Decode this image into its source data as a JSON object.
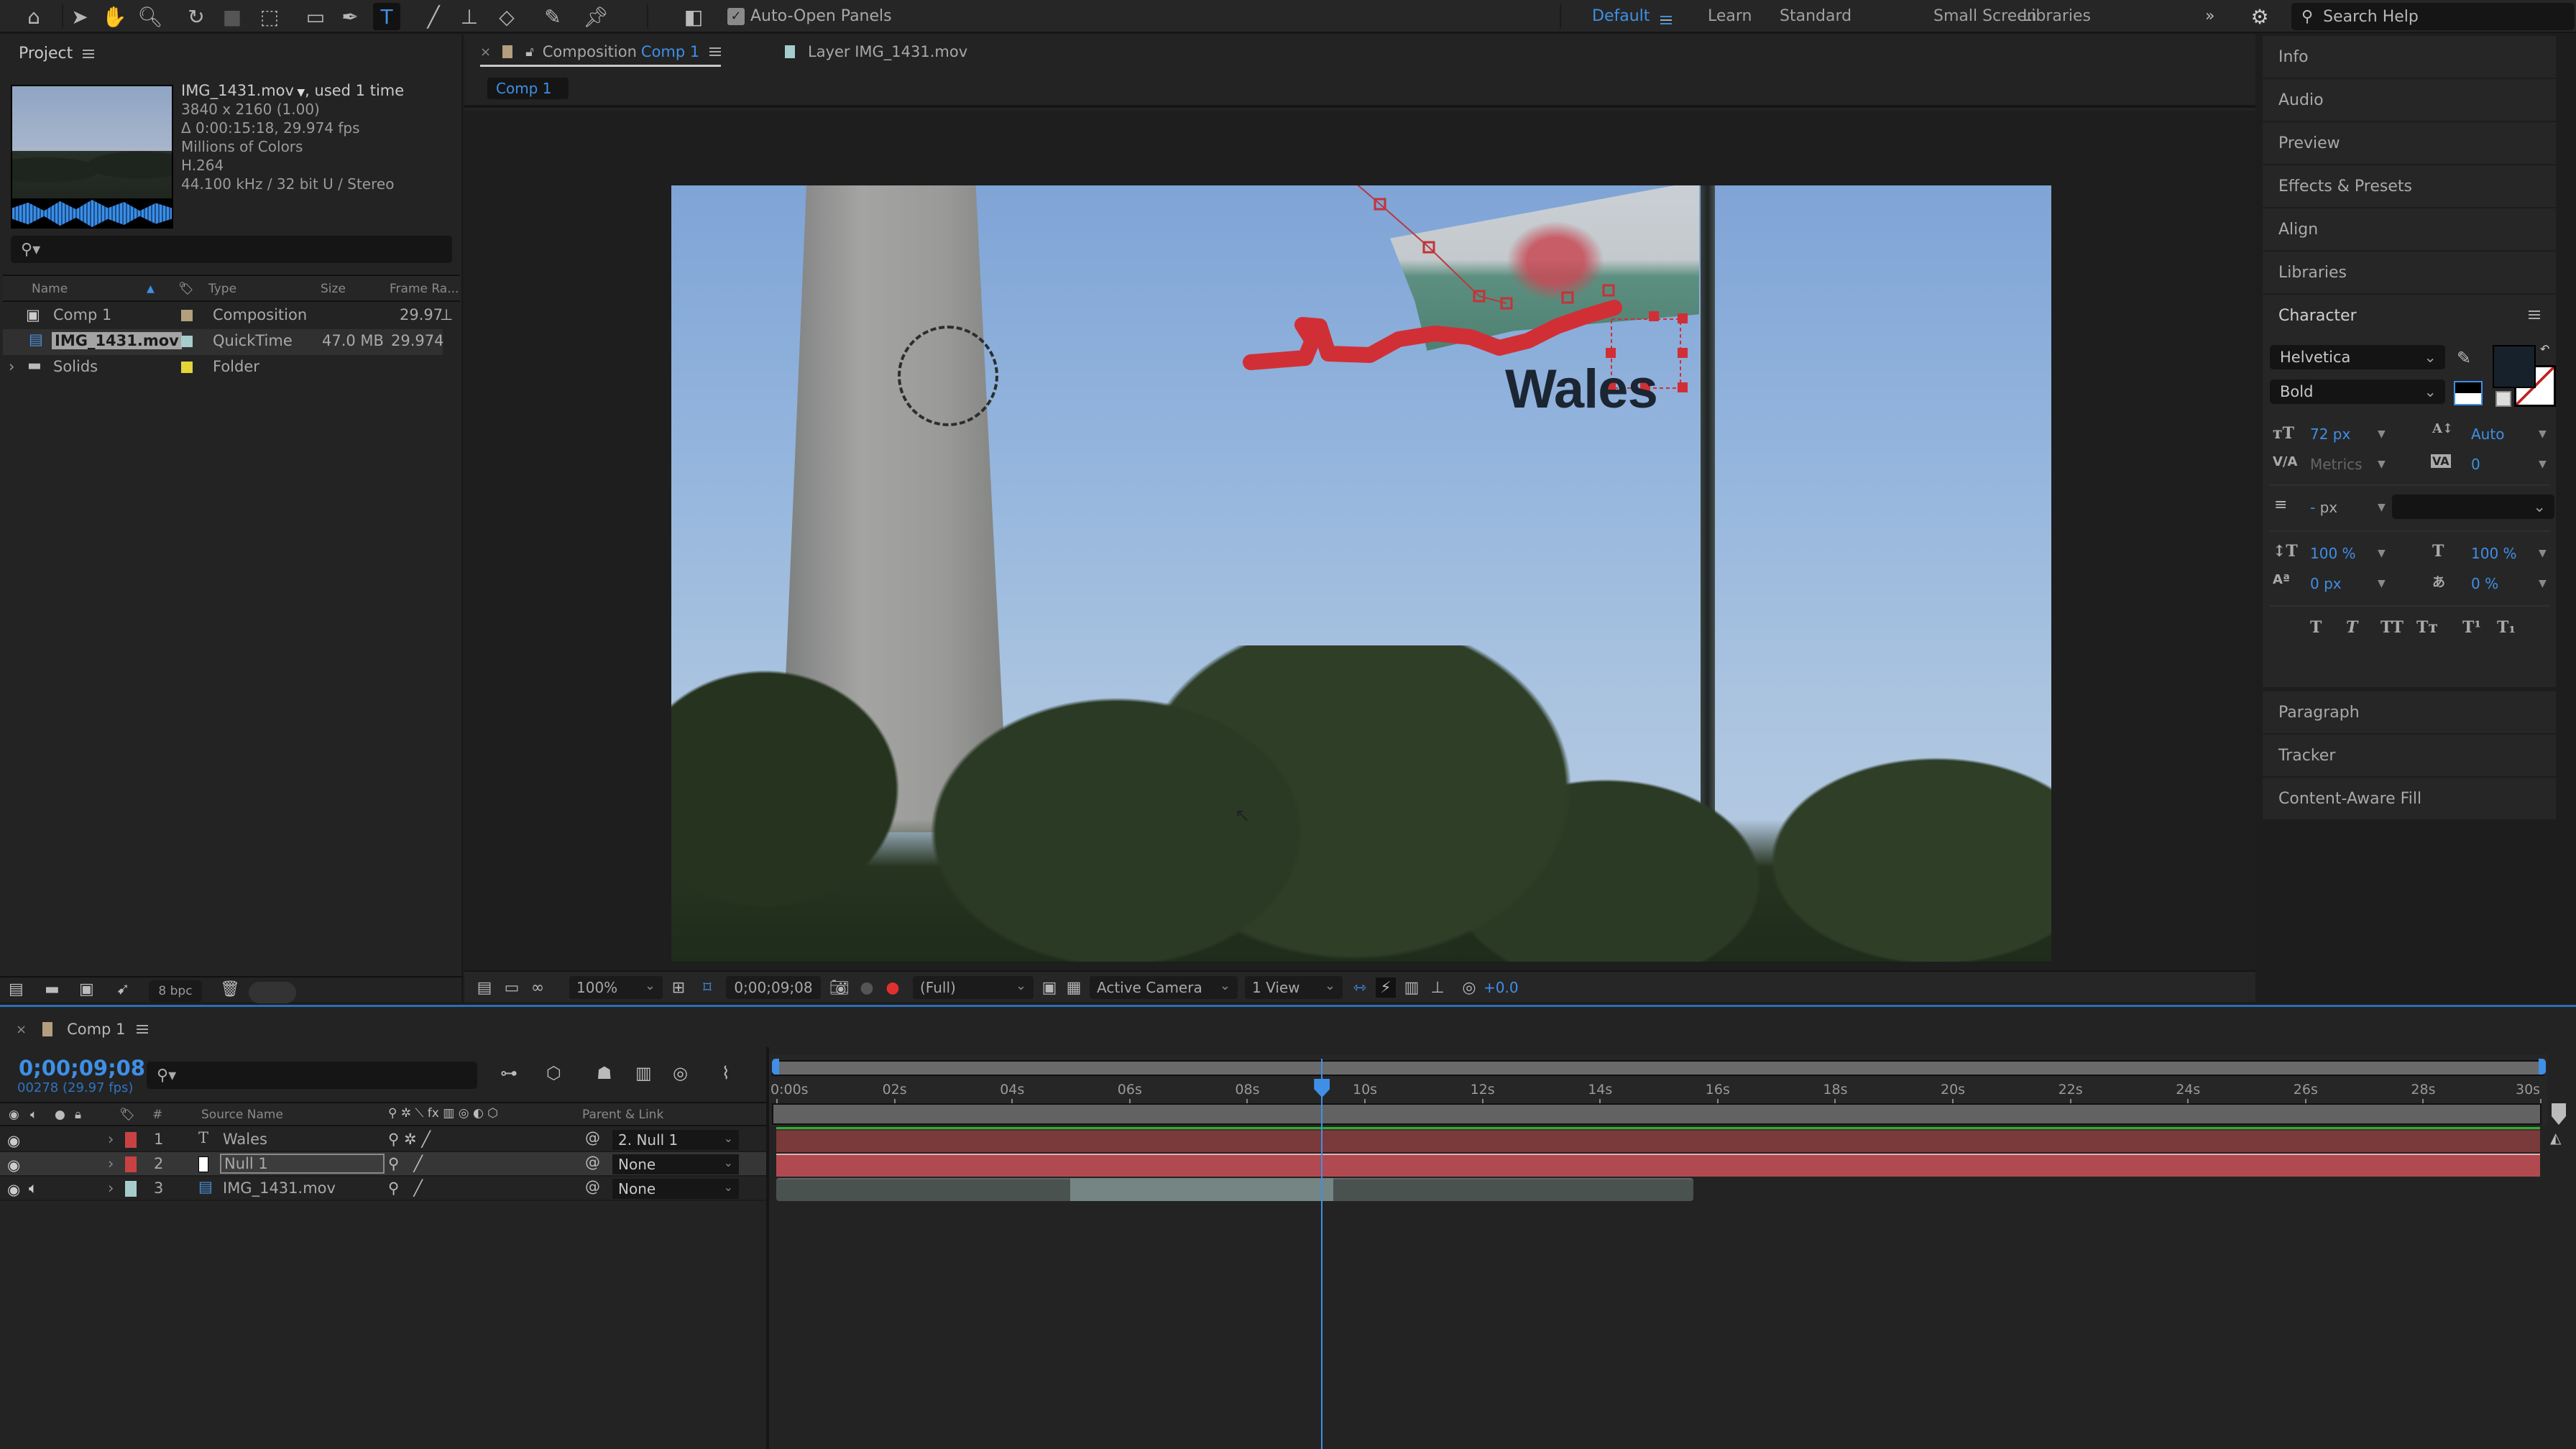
{
  "toolbar": {
    "auto_open_panels": "Auto-Open Panels",
    "workspaces": [
      "Default",
      "Learn",
      "Standard",
      "Small Screen",
      "Libraries"
    ],
    "active_workspace": "Default",
    "search_placeholder": "Search Help"
  },
  "project": {
    "title": "Project",
    "footage": {
      "name": "IMG_1431.mov",
      "used": ", used 1 time",
      "resolution": "3840 x 2160 (1.00)",
      "duration": "Δ 0:00:15:18, 29.974 fps",
      "colors": "Millions of Colors",
      "codec": "H.264",
      "audio": "44.100 kHz / 32 bit U / Stereo"
    },
    "columns": [
      "Name",
      "Type",
      "Size",
      "Frame Ra..."
    ],
    "items": [
      {
        "name": "Comp 1",
        "type": "Composition",
        "size": "",
        "fps": "29.97",
        "color": "#b39f7e"
      },
      {
        "name": "IMG_1431.mov",
        "type": "QuickTime",
        "size": "47.0 MB",
        "fps": "29.974",
        "color": "#a6cccb"
      },
      {
        "name": "Solids",
        "type": "Folder",
        "size": "",
        "fps": "",
        "color": "#e3d43a"
      }
    ],
    "bpc": "8 bpc"
  },
  "composition": {
    "tab_prefix": "Composition",
    "tab_name": "Comp 1",
    "layer_tab": "Layer IMG_1431.mov",
    "breadcrumb": "Comp 1",
    "overlay_text": "Wales",
    "viewer": {
      "zoom": "100%",
      "timecode": "0;00;09;08",
      "resolution": "(Full)",
      "camera": "Active Camera",
      "views": "1 View",
      "exposure": "+0.0"
    }
  },
  "right_panels": {
    "collapsed_top": [
      "Info",
      "Audio",
      "Preview",
      "Effects & Presets",
      "Align",
      "Libraries"
    ],
    "character": {
      "title": "Character",
      "font": "Helvetica",
      "style": "Bold",
      "font_size": "72 px",
      "leading": "Auto",
      "kerning": "Metrics",
      "tracking": "0",
      "stroke_width": "- px",
      "vertical_scale": "100 %",
      "horizontal_scale": "100 %",
      "baseline_shift": "0 px",
      "tsume": "0 %",
      "fill_color": "#16212b"
    },
    "collapsed_bottom": [
      "Paragraph",
      "Tracker",
      "Content-Aware Fill"
    ]
  },
  "timeline": {
    "tab": "Comp 1",
    "timecode": "0;00;09;08",
    "frames": "00278 (29.97 fps)",
    "columns": {
      "num": "#",
      "source": "Source Name",
      "parent": "Parent & Link"
    },
    "ruler_ticks": [
      "0:00s",
      "02s",
      "04s",
      "06s",
      "08s",
      "10s",
      "12s",
      "14s",
      "16s",
      "18s",
      "20s",
      "22s",
      "24s",
      "26s",
      "28s",
      "30s"
    ],
    "current_time_seconds": 9.27,
    "duration_seconds": 30,
    "layers": [
      {
        "num": "1",
        "name": "Wales",
        "kind": "text",
        "label_color": "#c84244",
        "parent": "2. Null 1",
        "start": 0,
        "end": 30
      },
      {
        "num": "2",
        "name": "Null 1",
        "kind": "null",
        "label_color": "#c84244",
        "parent": "None",
        "start": 0,
        "end": 30
      },
      {
        "num": "3",
        "name": "IMG_1431.mov",
        "kind": "footage",
        "label_color": "#a6cccb",
        "parent": "None",
        "start": 0,
        "end": 15.6
      }
    ]
  }
}
